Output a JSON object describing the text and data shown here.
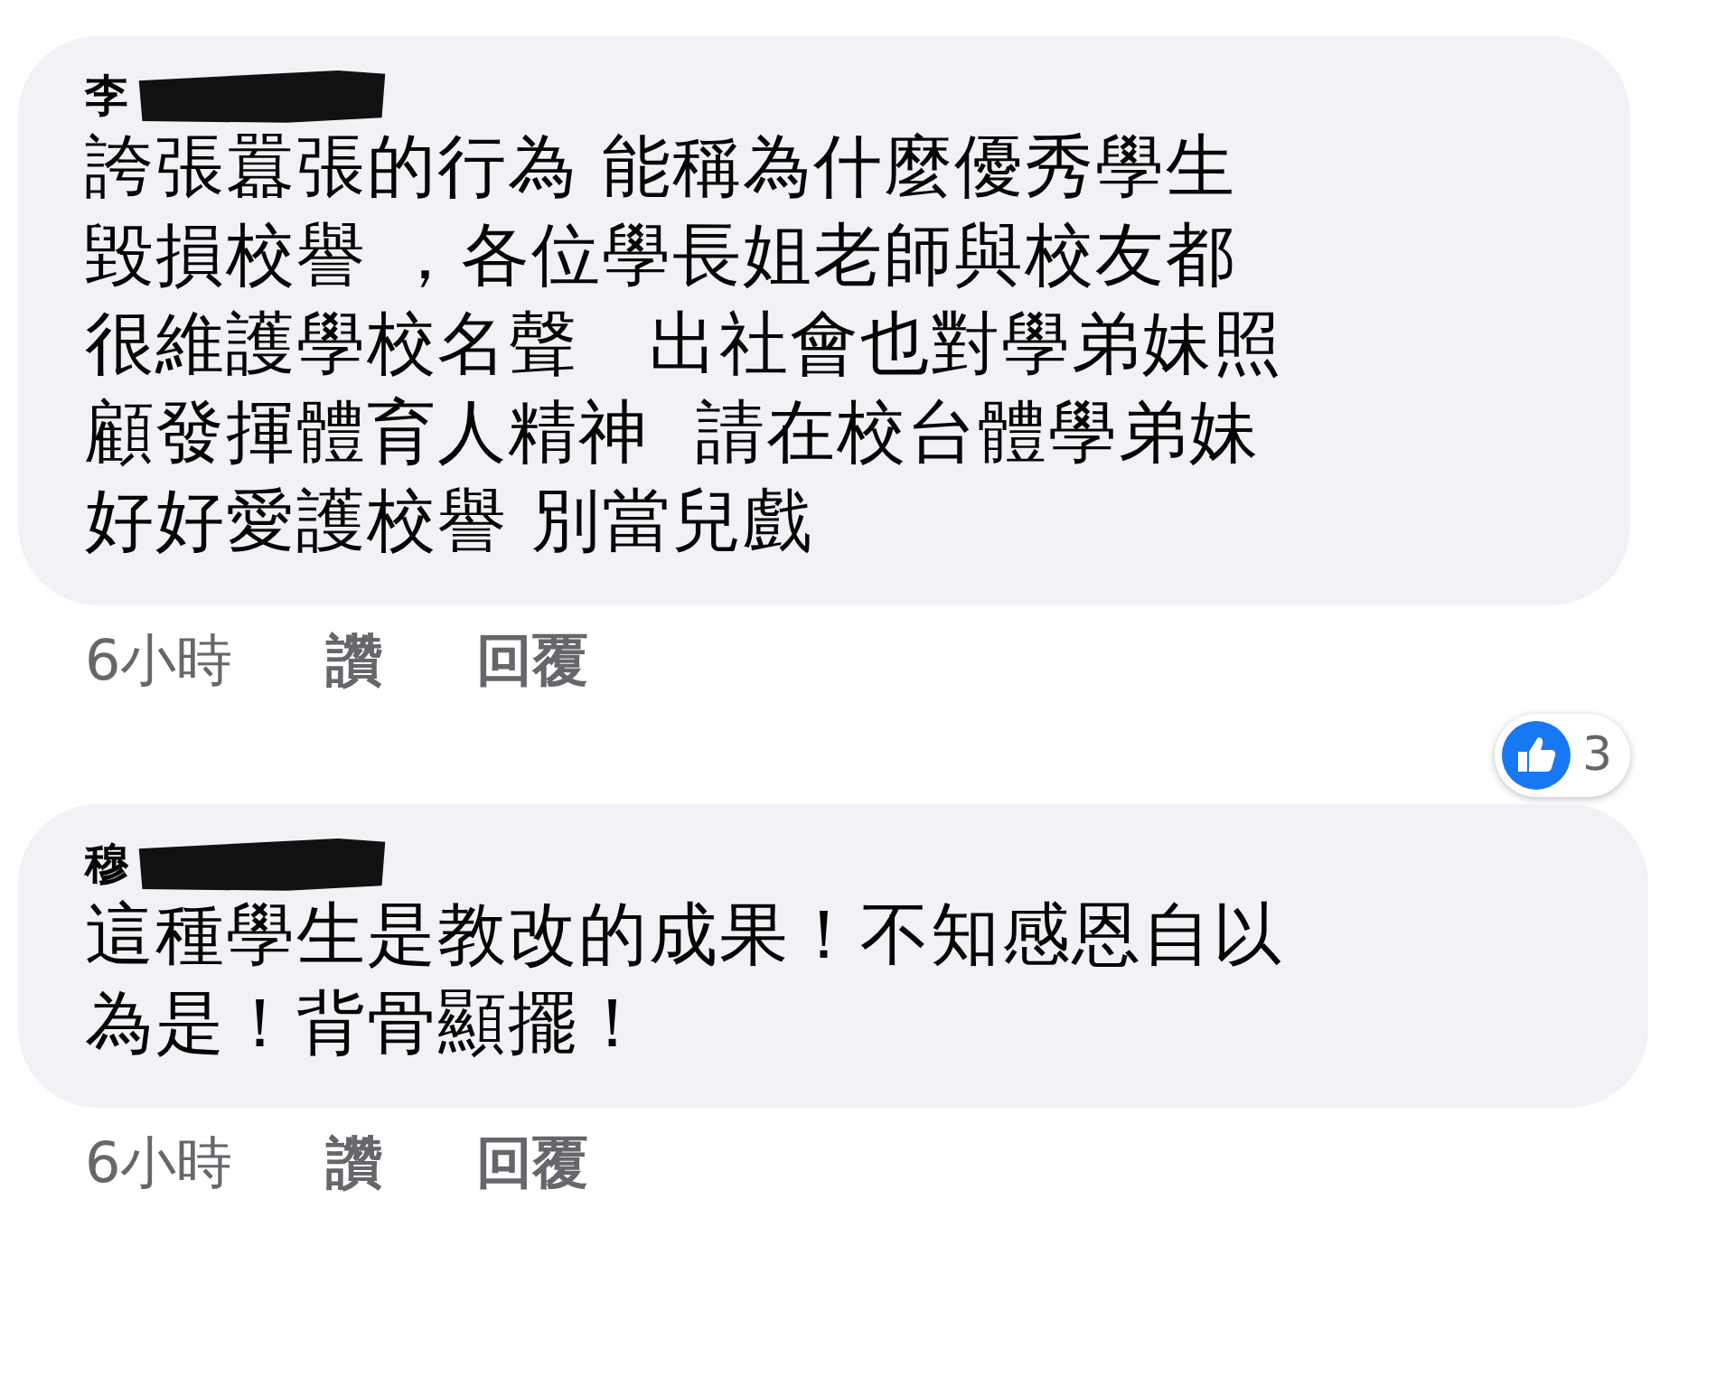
{
  "comments": [
    {
      "author": "李",
      "text": "誇張囂張的行為 能稱為什麼優秀學生毀損校譽 ，各位學長姐老師與校友都很維護學校名聲   出社會也對學弟妹照顧發揮體育人精神  請在校台體學弟妹好好愛護校譽 別當兒戲",
      "time": "6小時",
      "actions": [
        "讚",
        "回覆"
      ],
      "reactions": {
        "count": "3"
      }
    },
    {
      "author": "穆",
      "text": "這種學生是教改的成果！不知感恩自以為是！背骨顯擺！",
      "time": "6小時",
      "actions": [
        "讚",
        "回覆"
      ]
    }
  ]
}
